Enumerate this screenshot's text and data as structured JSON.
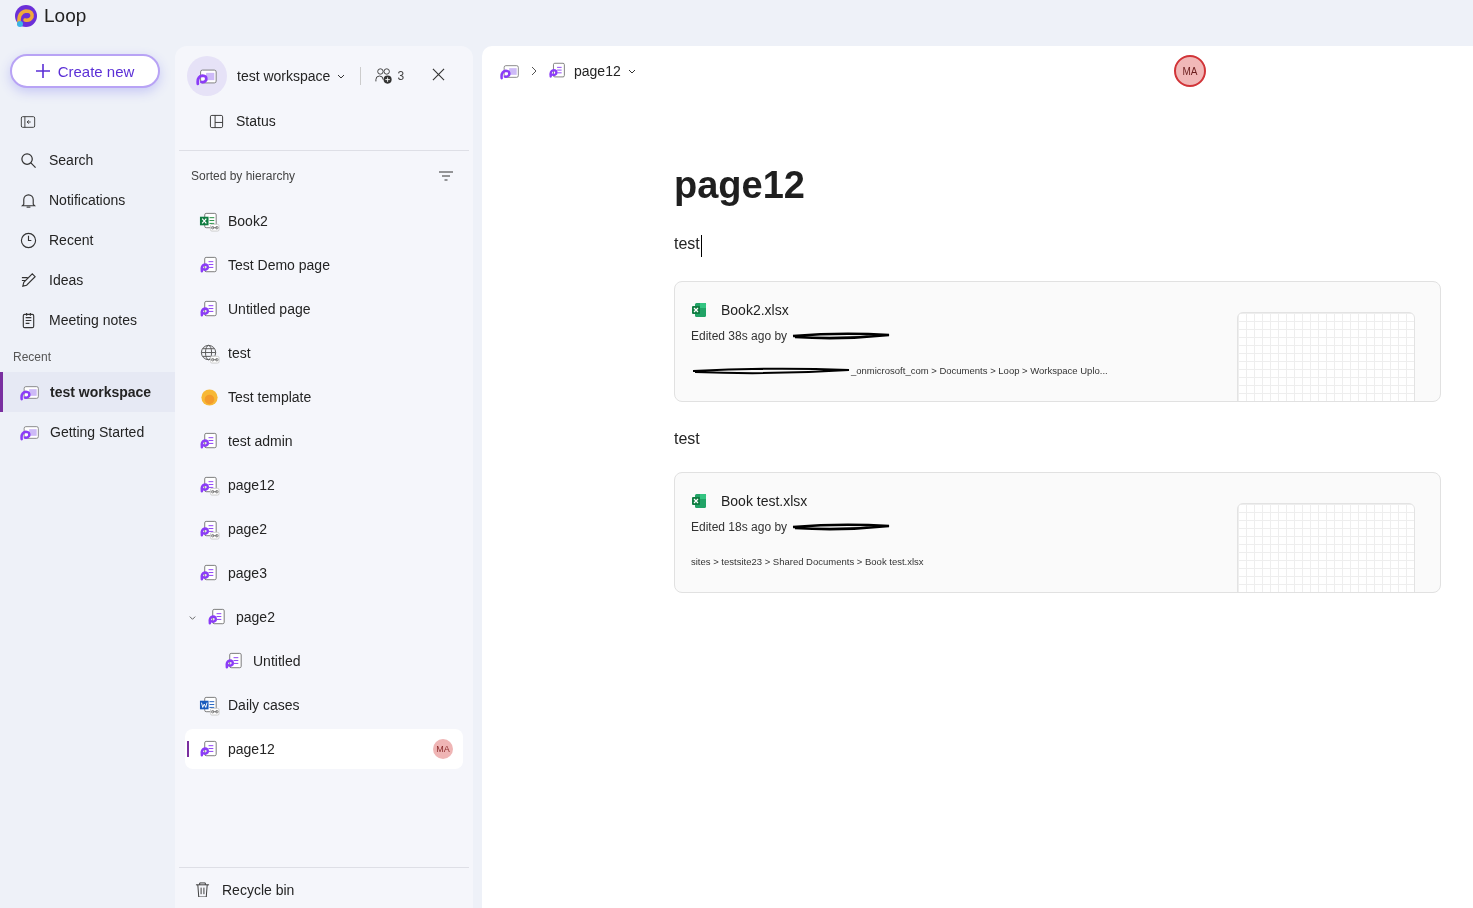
{
  "app": {
    "name": "Loop"
  },
  "nav": {
    "create_button": "Create new",
    "items": [
      {
        "label": "Search"
      },
      {
        "label": "Notifications"
      },
      {
        "label": "Recent"
      },
      {
        "label": "Ideas"
      },
      {
        "label": "Meeting notes"
      }
    ],
    "recent_heading": "Recent",
    "recent": [
      {
        "label": "test workspace",
        "selected": true
      },
      {
        "label": "Getting Started",
        "selected": false
      }
    ]
  },
  "workspace": {
    "name": "test workspace",
    "member_count": "3",
    "status": "Status",
    "sort_label": "Sorted by hierarchy",
    "tree": [
      {
        "label": "Book2",
        "kind": "excel",
        "linked": true,
        "selected": false
      },
      {
        "label": "Test Demo page",
        "kind": "loop",
        "linked": false,
        "selected": false
      },
      {
        "label": "Untitled page",
        "kind": "loop",
        "linked": false,
        "selected": false
      },
      {
        "label": "test",
        "kind": "web",
        "linked": true,
        "selected": false
      },
      {
        "label": "Test template",
        "kind": "template",
        "linked": false,
        "selected": false
      },
      {
        "label": "test admin",
        "kind": "loop",
        "linked": false,
        "selected": false
      },
      {
        "label": "page12",
        "kind": "loop",
        "linked": true,
        "selected": false
      },
      {
        "label": "page2",
        "kind": "loop",
        "linked": true,
        "selected": false
      },
      {
        "label": "page3",
        "kind": "loop",
        "linked": false,
        "selected": false
      },
      {
        "label": "page2",
        "kind": "loop",
        "linked": false,
        "selected": false,
        "expanded": true,
        "children": [
          {
            "label": "Untitled",
            "kind": "loop",
            "linked": false,
            "selected": false
          }
        ]
      },
      {
        "label": "Daily cases",
        "kind": "word",
        "linked": true,
        "selected": false
      },
      {
        "label": "page12",
        "kind": "loop",
        "linked": false,
        "selected": true,
        "avatar": "MA"
      }
    ],
    "recycle_bin": "Recycle bin"
  },
  "page": {
    "breadcrumb": "page12",
    "avatar": "MA",
    "title": "page12",
    "blocks": [
      {
        "kind": "text",
        "text": "test",
        "cursor": true
      },
      {
        "kind": "file-card",
        "name": "Book2.xlsx",
        "edited": "Edited 38s ago by",
        "redacted": true,
        "path": "_onmicrosoft_com > Documents > Loop > Workspace Uplo...",
        "path_redacted": true
      },
      {
        "kind": "text",
        "text": "test",
        "cursor": false
      },
      {
        "kind": "file-card",
        "name": "Book test.xlsx",
        "edited": "Edited 18s ago by",
        "redacted": true,
        "path": "sites > testsite23 > Shared Documents > Book test.xlsx",
        "path_redacted": false
      }
    ]
  }
}
